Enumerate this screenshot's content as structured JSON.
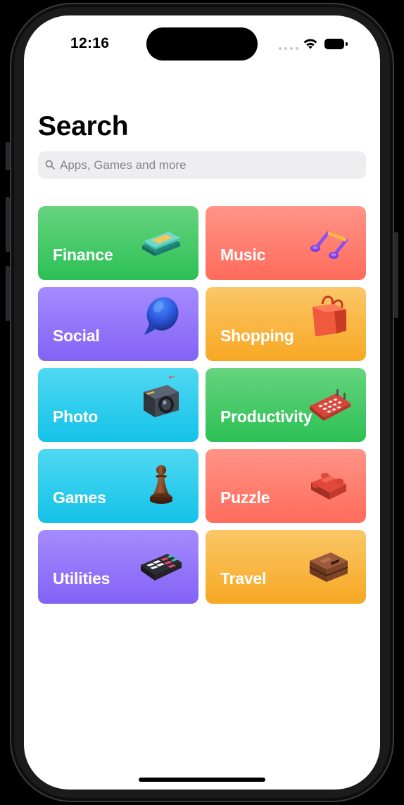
{
  "status_bar": {
    "time": "12:16"
  },
  "page": {
    "title": "Search"
  },
  "search": {
    "placeholder": "Apps, Games and more",
    "value": ""
  },
  "categories": [
    {
      "label": "Finance",
      "icon": "money-stack-icon",
      "color": "green"
    },
    {
      "label": "Music",
      "icon": "music-notes-icon",
      "color": "red"
    },
    {
      "label": "Social",
      "icon": "speech-bubble-icon",
      "color": "purple"
    },
    {
      "label": "Shopping",
      "icon": "shopping-bag-icon",
      "color": "orange"
    },
    {
      "label": "Photo",
      "icon": "camera-icon",
      "color": "cyan"
    },
    {
      "label": "Productivity",
      "icon": "calendar-icon",
      "color": "green"
    },
    {
      "label": "Games",
      "icon": "chess-pawn-icon",
      "color": "cyan"
    },
    {
      "label": "Puzzle",
      "icon": "puzzle-piece-icon",
      "color": "red"
    },
    {
      "label": "Utilities",
      "icon": "calculator-icon",
      "color": "purple"
    },
    {
      "label": "Travel",
      "icon": "suitcase-icon",
      "color": "orange"
    }
  ],
  "colors": {
    "green": "#34C759",
    "red": "#FF7B6B",
    "purple": "#8E6CF7",
    "orange": "#F8AE2F",
    "cyan": "#22C6EA",
    "search_background": "#EEEEF0",
    "placeholder": "#86868B"
  }
}
